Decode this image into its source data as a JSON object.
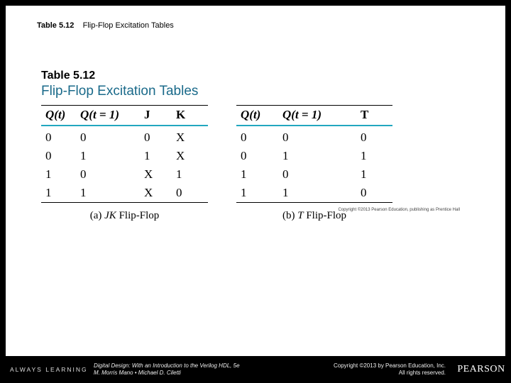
{
  "caption": {
    "number": "Table 5.12",
    "title": "Flip-Flop Excitation Tables"
  },
  "figure": {
    "number": "Table 5.12",
    "title": "Flip-Flop Excitation Tables",
    "tiny_copyright": "Copyright ©2013 Pearson Education, publishing as Prentice Hall"
  },
  "jk": {
    "headers": [
      "Q(t)",
      "Q(t = 1)",
      "J",
      "K"
    ],
    "rows": [
      [
        "0",
        "0",
        "0",
        "X"
      ],
      [
        "0",
        "1",
        "1",
        "X"
      ],
      [
        "1",
        "0",
        "X",
        "1"
      ],
      [
        "1",
        "1",
        "X",
        "0"
      ]
    ],
    "subcaption_label": "(a)",
    "subcaption_name": "JK",
    "subcaption_suffix": " Flip-Flop"
  },
  "t": {
    "headers": [
      "Q(t)",
      "Q(t = 1)",
      "T"
    ],
    "rows": [
      [
        "0",
        "0",
        "0"
      ],
      [
        "0",
        "1",
        "1"
      ],
      [
        "1",
        "0",
        "1"
      ],
      [
        "1",
        "1",
        "0"
      ]
    ],
    "subcaption_label": "(b)",
    "subcaption_name": "T",
    "subcaption_suffix": " Flip-Flop"
  },
  "footer": {
    "brand": "ALWAYS LEARNING",
    "book_line1": "Digital Design: With an Introduction to the Verilog HDL, 5e",
    "book_line2": "M. Morris Mano • Michael D. Ciletti",
    "copy_line1": "Copyright ©2013 by Pearson Education, Inc.",
    "copy_line2": "All rights reserved.",
    "logo": "PEARSON"
  },
  "chart_data": [
    {
      "type": "table",
      "title": "JK Flip-Flop Excitation Table",
      "columns": [
        "Q(t)",
        "Q(t+1)",
        "J",
        "K"
      ],
      "rows": [
        [
          0,
          0,
          "0",
          "X"
        ],
        [
          0,
          1,
          "1",
          "X"
        ],
        [
          1,
          0,
          "X",
          "1"
        ],
        [
          1,
          1,
          "X",
          "0"
        ]
      ]
    },
    {
      "type": "table",
      "title": "T Flip-Flop Excitation Table",
      "columns": [
        "Q(t)",
        "Q(t+1)",
        "T"
      ],
      "rows": [
        [
          0,
          0,
          0
        ],
        [
          0,
          1,
          1
        ],
        [
          1,
          0,
          1
        ],
        [
          1,
          1,
          0
        ]
      ]
    }
  ]
}
